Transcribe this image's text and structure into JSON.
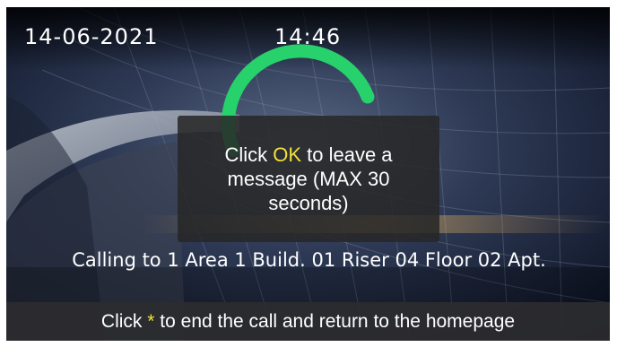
{
  "status_bar": {
    "date": "14-06-2021",
    "time": "14:46"
  },
  "call_progress": {
    "indicator_color": "#27d16b"
  },
  "dialog": {
    "prefix": "Click ",
    "key": "OK",
    "suffix": " to leave a message (MAX 30 seconds)"
  },
  "calling": {
    "text": "Calling to 1 Area 1 Build. 01 Riser 04 Floor 02 Apt."
  },
  "footer": {
    "prefix": "Click ",
    "key": "*",
    "suffix": " to end the call and return to the homepage"
  },
  "colors": {
    "highlight": "#f3e13a",
    "overlay": "#262626"
  },
  "icons": {
    "call_indicator": "progress-ring-icon"
  }
}
